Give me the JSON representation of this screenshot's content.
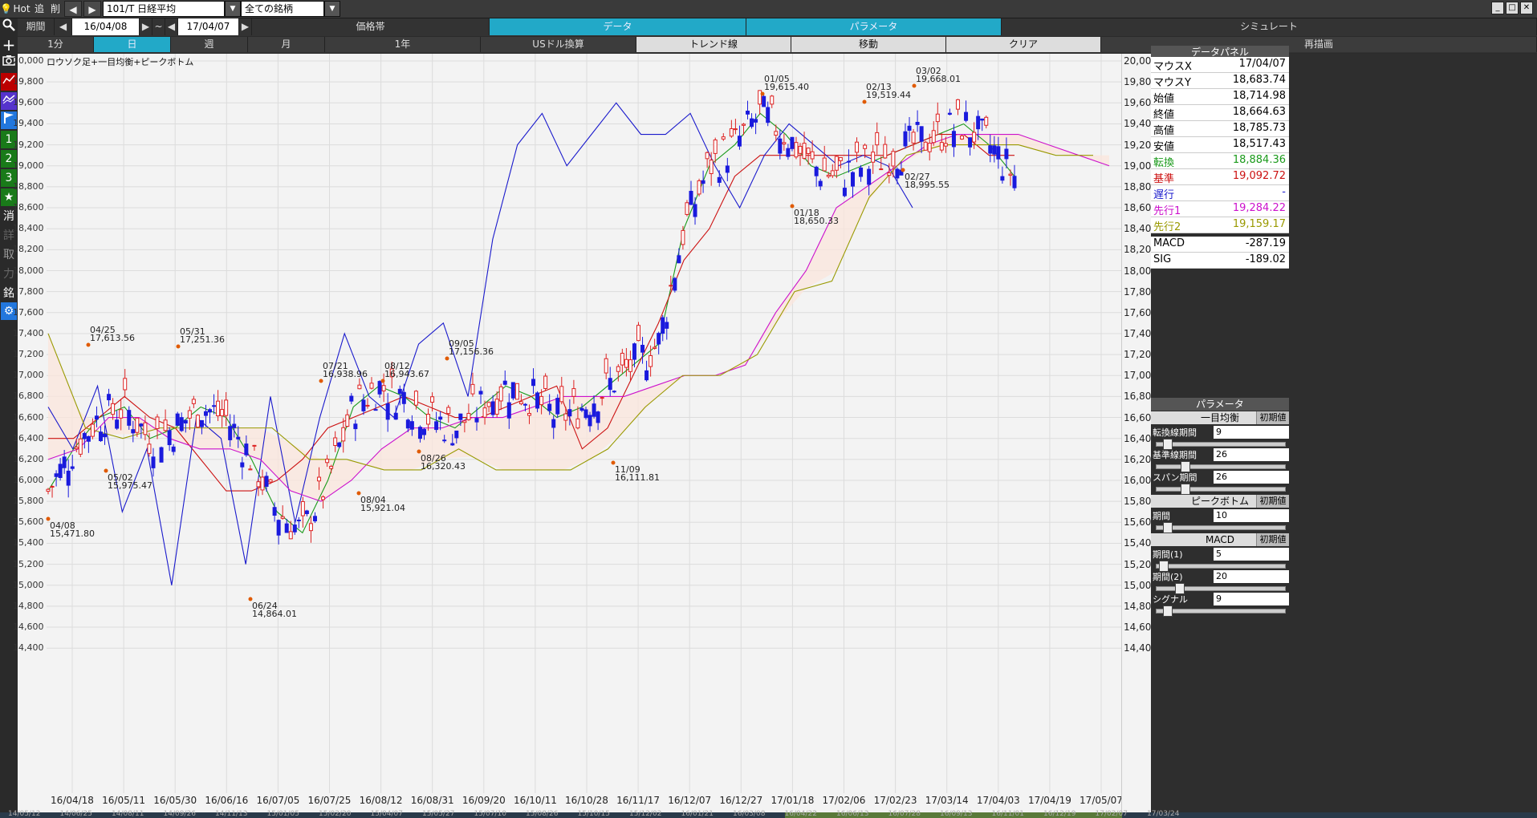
{
  "topbar": {
    "hot": "Hot",
    "add": "追",
    "del": "削",
    "symbol": "101/T 日経平均",
    "market": "全ての銘柄"
  },
  "row2": {
    "period_label": "期間",
    "date_from": "16/04/08",
    "tilde": "~",
    "date_to": "17/04/07",
    "price_band": "価格帯",
    "data": "データ",
    "parameter": "パラメータ",
    "simulate": "シミュレート"
  },
  "row3": {
    "tabs": [
      "1分",
      "日",
      "週",
      "月",
      "1年",
      "USドル換算",
      "トレンド線",
      "移動",
      "クリア",
      "再描画"
    ]
  },
  "sidebar": {
    "icons": [
      "search-icon",
      "plus-icon",
      "camera-icon",
      "chart-icon",
      "chart2-icon",
      "flag-icon"
    ],
    "numbers": [
      "1",
      "2",
      "3"
    ],
    "star": "★",
    "labels": [
      "消",
      "詳",
      "取",
      "力",
      "銘"
    ]
  },
  "chart": {
    "title": "ロウソク足+一目均衡+ピークボトム",
    "y_ticks": [
      "20,000",
      "19,800",
      "19,600",
      "19,400",
      "19,200",
      "19,000",
      "18,800",
      "18,600",
      "18,400",
      "18,200",
      "18,000",
      "17,800",
      "17,600",
      "17,400",
      "17,200",
      "17,000",
      "16,800",
      "16,600",
      "16,400",
      "16,200",
      "16,000",
      "15,800",
      "15,600",
      "15,400",
      "15,200",
      "15,000",
      "14,800",
      "14,600",
      "14,400"
    ],
    "x_ticks": [
      "16/04/18",
      "16/05/11",
      "16/05/30",
      "16/06/16",
      "16/07/05",
      "16/07/25",
      "16/08/12",
      "16/08/31",
      "16/09/20",
      "16/10/11",
      "16/10/28",
      "16/11/17",
      "16/12/07",
      "16/12/27",
      "17/01/18",
      "17/02/06",
      "17/02/23",
      "17/03/14",
      "17/04/03",
      "17/04/19",
      "17/05/07"
    ],
    "bottom_ticks": [
      "14/05/12",
      "14/06/25",
      "14/08/11",
      "14/09/26",
      "14/11/13",
      "15/01/05",
      "15/02/20",
      "15/04/07",
      "15/05/27",
      "15/07/10",
      "15/08/26",
      "15/10/15",
      "15/12/02",
      "16/01/21",
      "16/03/08",
      "16/04/22",
      "16/06/13",
      "16/07/28",
      "16/09/13",
      "16/11/01",
      "16/12/19",
      "17/02/07",
      "17/03/24"
    ],
    "annotations": [
      {
        "date": "04/25",
        "value": "17,613.56"
      },
      {
        "date": "04/08",
        "value": "15,471.80"
      },
      {
        "date": "05/02",
        "value": "15,975.47"
      },
      {
        "date": "05/31",
        "value": "17,251.36"
      },
      {
        "date": "06/24",
        "value": "14,864.01"
      },
      {
        "date": "07/21",
        "value": "16,938.96"
      },
      {
        "date": "08/12",
        "value": "16,943.67"
      },
      {
        "date": "08/04",
        "value": "15,921.04"
      },
      {
        "date": "09/05",
        "value": "17,156.36"
      },
      {
        "date": "08/26",
        "value": "16,320.43"
      },
      {
        "date": "11/09",
        "value": "16,111.81"
      },
      {
        "date": "01/05",
        "value": "19,615.40"
      },
      {
        "date": "01/18",
        "value": "18,650.33"
      },
      {
        "date": "02/13",
        "value": "19,519.44"
      },
      {
        "date": "02/27",
        "value": "18,995.55"
      },
      {
        "date": "03/02",
        "value": "19,668.01"
      }
    ]
  },
  "panel": {
    "data_title": "データパネル",
    "rows": [
      {
        "key": "マウスX",
        "value": "17/04/07",
        "color": "#000000"
      },
      {
        "key": "マウスY",
        "value": "18,683.74",
        "color": "#000000"
      },
      {
        "key": "始値",
        "value": "18,714.98",
        "color": "#000000"
      },
      {
        "key": "終値",
        "value": "18,664.63",
        "color": "#000000"
      },
      {
        "key": "高値",
        "value": "18,785.73",
        "color": "#000000"
      },
      {
        "key": "安値",
        "value": "18,517.43",
        "color": "#000000"
      },
      {
        "key": "転換",
        "value": "18,884.36",
        "color": "#1a9a1a"
      },
      {
        "key": "基準",
        "value": "19,092.72",
        "color": "#cc1111"
      },
      {
        "key": "遅行",
        "value": "-",
        "color": "#1a1acc"
      },
      {
        "key": "先行1",
        "value": "19,284.22",
        "color": "#cc11cc"
      },
      {
        "key": "先行2",
        "value": "19,159.17",
        "color": "#999900"
      },
      {
        "key": "MACD",
        "value": "-287.19",
        "color": "#000000"
      },
      {
        "key": "SIG",
        "value": "-189.02",
        "color": "#000000"
      }
    ],
    "param_title": "パラメータ",
    "sections": [
      {
        "title": "一目均衡",
        "reset": "初期値",
        "params": [
          {
            "label": "転換線期間",
            "value": "9",
            "level": 0.05
          },
          {
            "label": "基準線期間",
            "value": "26",
            "level": 0.2
          },
          {
            "label": "スパン期間",
            "value": "26",
            "level": 0.2
          }
        ]
      },
      {
        "title": "ピークボトム",
        "reset": "初期値",
        "params": [
          {
            "label": "期間",
            "value": "10",
            "level": 0.05
          }
        ]
      },
      {
        "title": "MACD",
        "reset": "初期値",
        "params": [
          {
            "label": "期間(1)",
            "value": "5",
            "level": 0.02
          },
          {
            "label": "期間(2)",
            "value": "20",
            "level": 0.15
          },
          {
            "label": "シグナル",
            "value": "9",
            "level": 0.05
          }
        ]
      }
    ]
  },
  "chart_data": {
    "type": "line",
    "title": "ロウソク足+一目均衡+ピークボトム",
    "ylim": [
      14400,
      20000
    ],
    "series": [
      {
        "name": "転換",
        "color": "#1a9a1a",
        "values": [
          15900,
          16300,
          16600,
          16700,
          16400,
          16500,
          16700,
          16600,
          16200,
          15700,
          15500,
          16000,
          16700,
          16900,
          16800,
          16600,
          16500,
          16700,
          16900,
          16800,
          16600,
          16700,
          16900,
          17100,
          17300,
          18400,
          19000,
          19200,
          19500,
          19300,
          19000,
          18900,
          19000,
          19100,
          19200,
          19300,
          19400,
          19200,
          18900
        ]
      },
      {
        "name": "基準",
        "color": "#cc1111",
        "values": [
          16400,
          16400,
          16600,
          16800,
          16600,
          16500,
          16200,
          15900,
          15900,
          16000,
          16200,
          16500,
          16600,
          16700,
          16800,
          16700,
          16600,
          16600,
          16700,
          16800,
          16900,
          16300,
          16500,
          17000,
          17500,
          18100,
          18400,
          18900,
          19100,
          19100,
          19100,
          19100,
          19100,
          19100,
          19200,
          19300,
          19300,
          19100,
          19100
        ]
      },
      {
        "name": "遅行",
        "color": "#1a1acc",
        "values": [
          16700,
          16300,
          16900,
          15700,
          16300,
          15000,
          16600,
          16400,
          15200,
          16800,
          15600,
          16600,
          17400,
          16800,
          16600,
          17300,
          17500,
          16800,
          18300,
          19200,
          19500,
          19000,
          19300,
          19600,
          19300,
          19300,
          19500,
          19000,
          18600,
          19100,
          19400,
          19200,
          19000,
          19100,
          19000,
          18600
        ]
      },
      {
        "name": "先行1",
        "color": "#cc11cc",
        "values": [
          16200,
          16300,
          16600,
          16600,
          16400,
          16300,
          16300,
          16200,
          15900,
          15800,
          16000,
          16300,
          16500,
          16500,
          16600,
          16600,
          16700,
          16800,
          16800,
          16800,
          16900,
          17000,
          17000,
          17100,
          17600,
          18000,
          18600,
          18800,
          19000,
          19200,
          19300,
          19300,
          19300,
          19200,
          19100,
          19000
        ]
      },
      {
        "name": "先行2",
        "color": "#999900",
        "values": [
          17400,
          16500,
          16400,
          16500,
          16500,
          16500,
          16500,
          16200,
          16200,
          16100,
          16100,
          16300,
          16100,
          16100,
          16100,
          16300,
          16700,
          17000,
          17000,
          17200,
          17800,
          17900,
          18700,
          19100,
          19200,
          19200,
          19200,
          19100,
          19100
        ]
      }
    ]
  }
}
